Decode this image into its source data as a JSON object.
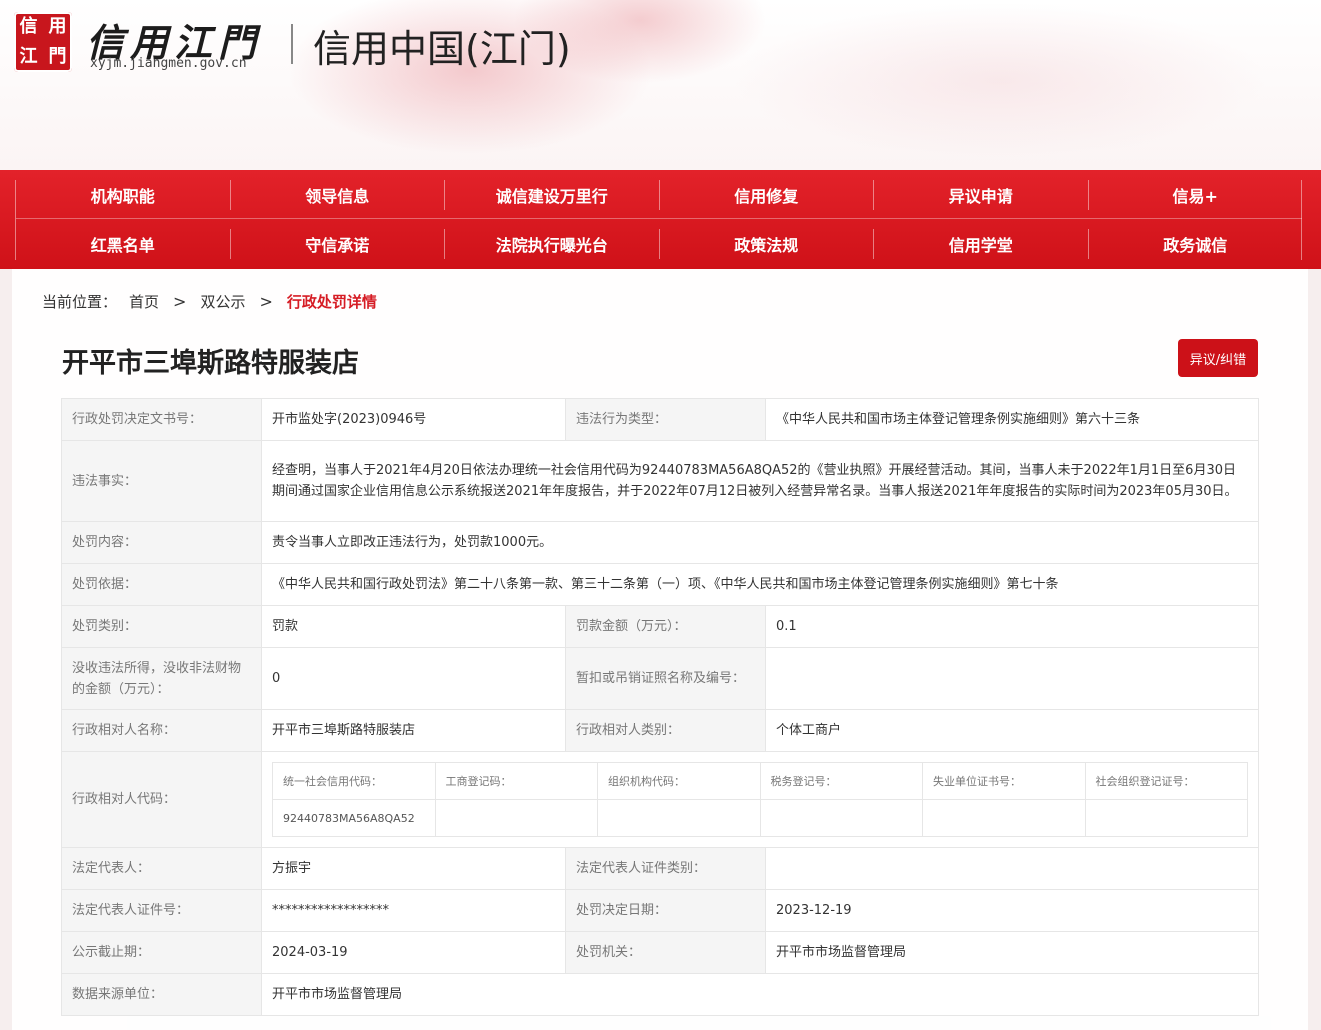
{
  "header": {
    "seal_chars": [
      "信",
      "用",
      "江",
      "門"
    ],
    "logo_title": "信用江門",
    "domain": "xyjm.jiangmen.gov.cn",
    "site_title": "信用中国(江门)"
  },
  "nav": {
    "row1": [
      "机构职能",
      "领导信息",
      "诚信建设万里行",
      "信用修复",
      "异议申请",
      "信易+"
    ],
    "row2": [
      "红黑名单",
      "守信承诺",
      "法院执行曝光台",
      "政策法规",
      "信用学堂",
      "政务诚信"
    ]
  },
  "breadcrumb": {
    "label": "当前位置：",
    "items": [
      "首页",
      "双公示"
    ],
    "separator": ">",
    "current": "行政处罚详情"
  },
  "entity": {
    "title": "开平市三埠斯路特服装店",
    "dispute_button": "异议/纠错"
  },
  "detail": {
    "decision_no_label": "行政处罚决定文书号：",
    "decision_no": "开市监处字(2023)0946号",
    "violation_type_label": "违法行为类型：",
    "violation_type": "《中华人民共和国市场主体登记管理条例实施细则》第六十三条",
    "facts_label": "违法事实：",
    "facts": "经查明，当事人于2021年4月20日依法办理统一社会信用代码为92440783MA56A8QA52的《营业执照》开展经营活动。其间，当事人未于2022年1月1日至6月30日期间通过国家企业信用信息公示系统报送2021年年度报告，并于2022年07月12日被列入经营异常名录。当事人报送2021年年度报告的实际时间为2023年05月30日。",
    "content_label": "处罚内容：",
    "content": "责令当事人立即改正违法行为，处罚款1000元。",
    "basis_label": "处罚依据：",
    "basis": "《中华人民共和国行政处罚法》第二十八条第一款、第三十二条第（一）项、《中华人民共和国市场主体登记管理条例实施细则》第七十条",
    "category_label": "处罚类别：",
    "category": "罚款",
    "amount_label": "罚款金额（万元）：",
    "amount": "0.1",
    "confiscated_label": "没收违法所得，没收非法财物的金额（万元）：",
    "confiscated": "0",
    "license_label": "暂扣或吊销证照名称及编号：",
    "license": "",
    "party_name_label": "行政相对人名称：",
    "party_name": "开平市三埠斯路特服装店",
    "party_type_label": "行政相对人类别：",
    "party_type": "个体工商户",
    "party_code_label": "行政相对人代码：",
    "codes": {
      "headers": [
        "统一社会信用代码：",
        "工商登记码：",
        "组织机构代码：",
        "税务登记号：",
        "失业单位证书号：",
        "社会组织登记证号："
      ],
      "values": [
        "92440783MA56A8QA52",
        "",
        "",
        "",
        "",
        ""
      ]
    },
    "legal_rep_label": "法定代表人：",
    "legal_rep": "方振宇",
    "legal_rep_id_type_label": "法定代表人证件类别：",
    "legal_rep_id_type": "",
    "legal_rep_id_label": "法定代表人证件号：",
    "legal_rep_id": "******************",
    "decision_date_label": "处罚决定日期：",
    "decision_date": "2023-12-19",
    "publicity_end_label": "公示截止期：",
    "publicity_end": "2024-03-19",
    "authority_label": "处罚机关：",
    "authority": "开平市市场监督管理局",
    "source_label": "数据来源单位：",
    "source": "开平市市场监督管理局"
  }
}
